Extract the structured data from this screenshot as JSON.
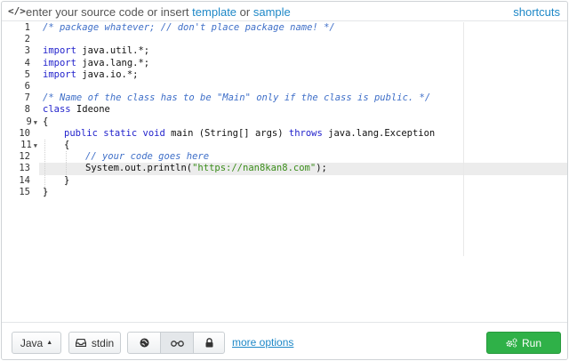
{
  "topbar": {
    "code_icon": "</>",
    "hint_prefix": "enter your source code or insert",
    "template_link": "template",
    "or_text": "or",
    "sample_link": "sample",
    "shortcuts_link": "shortcuts"
  },
  "editor": {
    "highlighted_line": 13,
    "line_numbers": [
      "1",
      "2",
      "3",
      "4",
      "5",
      "6",
      "7",
      "8",
      "9",
      "10",
      "11",
      "12",
      "13",
      "14",
      "15"
    ],
    "lines": {
      "l1": "/* package whatever; // don't place package name! */",
      "l3_kw": "import",
      "l3_rest": " java.util.*;",
      "l4_kw": "import",
      "l4_rest": " java.lang.*;",
      "l5_kw": "import",
      "l5_rest": " java.io.*;",
      "l7": "/* Name of the class has to be \"Main\" only if the class is public. */",
      "l8_kw": "class",
      "l8_rest": " Ideone",
      "l9": "{",
      "l10_kw1": "public static void",
      "l10_mid": " main (String[] args) ",
      "l10_kw2": "throws",
      "l10_rest": " java.lang.Exception",
      "l11": "{",
      "l12": "// your code goes here",
      "l13_pre": "System.out.println(",
      "l13_str": "\"https://nan8kan8.com\"",
      "l13_post": ");",
      "l14": "}",
      "l15": "}"
    }
  },
  "bottombar": {
    "language_label": "Java",
    "stdin_label": "stdin",
    "more_options_label": "more options",
    "run_label": "Run"
  },
  "colors": {
    "link": "#1e88c7",
    "run": "#2fb148",
    "keyword": "#2222cc",
    "comment": "#3f6fc8",
    "string": "#3a8d1a"
  }
}
